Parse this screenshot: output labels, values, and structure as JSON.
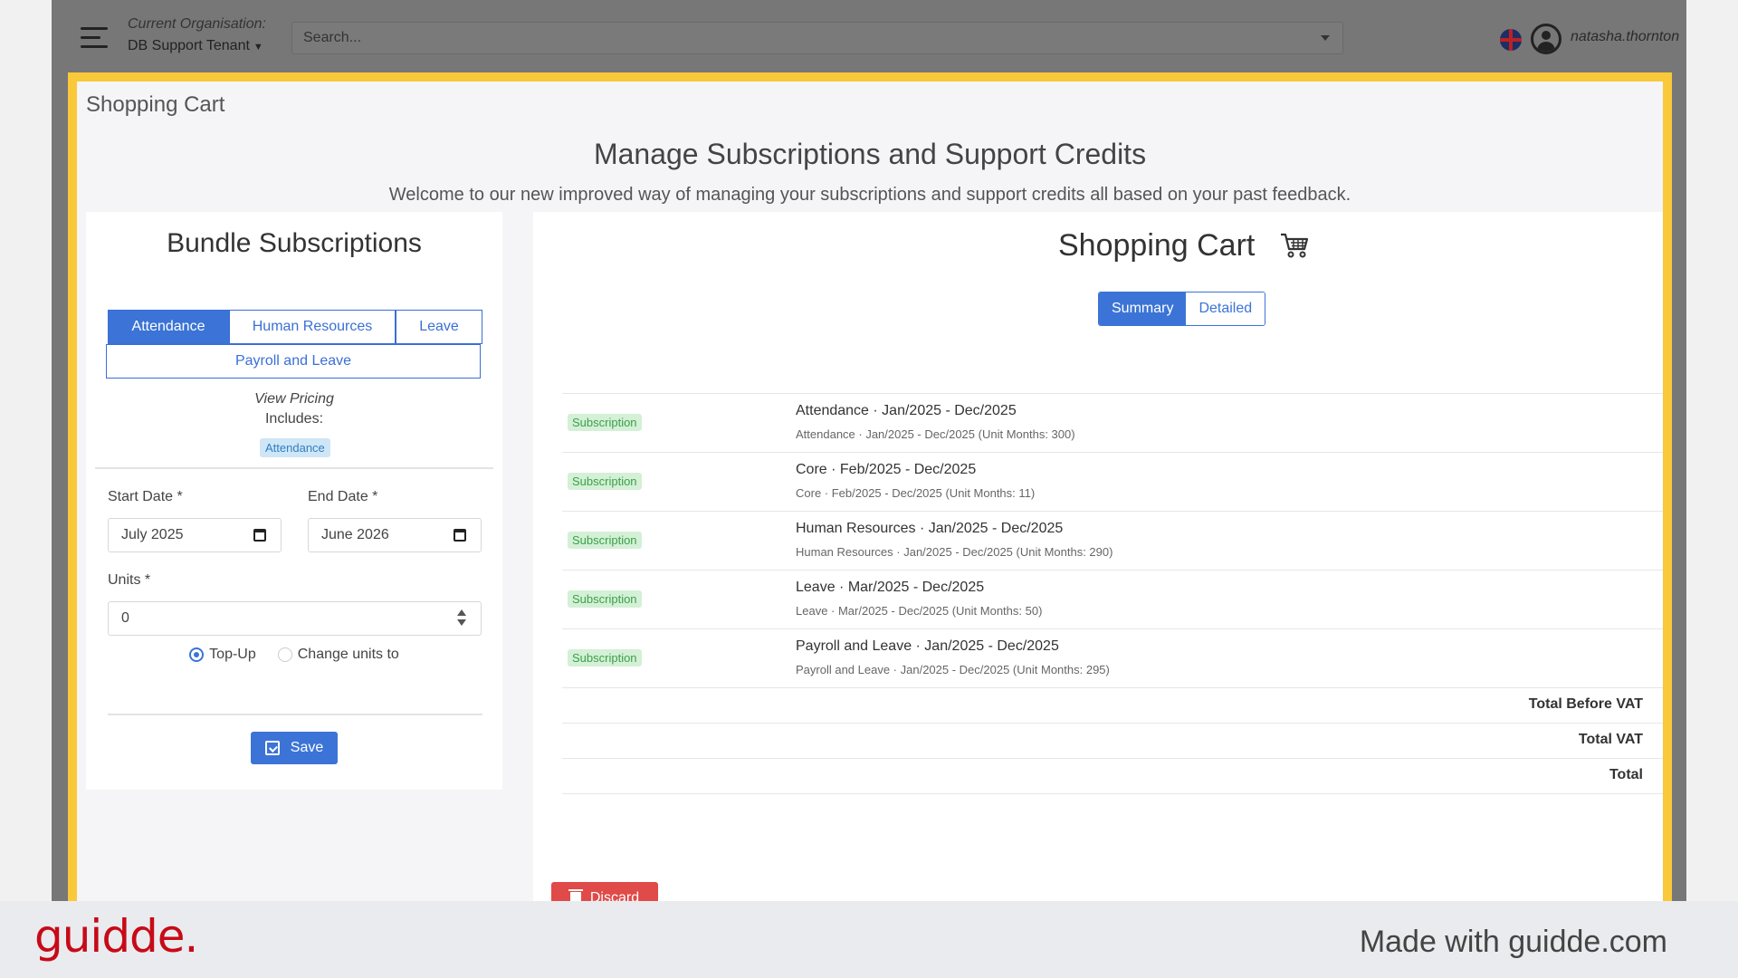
{
  "navbar": {
    "org_label": "Current Organisation:",
    "org_value": "DB Support Tenant",
    "search_placeholder": "Search...",
    "username": "natasha.thornton"
  },
  "page": {
    "heading": "Shopping Cart",
    "title": "Manage Subscriptions and Support Credits",
    "subtitle": "Welcome to our new improved way of managing your subscriptions and support credits all based on your past feedback."
  },
  "bundle": {
    "title": "Bundle Subscriptions",
    "tabs": [
      "Attendance",
      "Human Resources",
      "Leave"
    ],
    "tab_wide": "Payroll and Leave",
    "active_tab": "Attendance",
    "view_pricing": "View Pricing",
    "includes_label": "Includes:",
    "includes_badge": "Attendance",
    "start_date_label": "Start Date *",
    "start_date_value": "July 2025",
    "end_date_label": "End Date *",
    "end_date_value": "June 2026",
    "units_label": "Units *",
    "units_value": "0",
    "radio_topup": "Top-Up",
    "radio_change": "Change units to",
    "save_label": "Save"
  },
  "cart": {
    "title": "Shopping Cart",
    "toggle_summary": "Summary",
    "toggle_detailed": "Detailed",
    "items": [
      {
        "badge": "Subscription",
        "title": "Attendance · Jan/2025 - Dec/2025",
        "sub": "Attendance · Jan/2025 - Dec/2025 (Unit Months: 300)"
      },
      {
        "badge": "Subscription",
        "title": "Core · Feb/2025 - Dec/2025",
        "sub": "Core · Feb/2025 - Dec/2025 (Unit Months: 11)"
      },
      {
        "badge": "Subscription",
        "title": "Human Resources · Jan/2025 - Dec/2025",
        "sub": "Human Resources · Jan/2025 - Dec/2025 (Unit Months: 290)"
      },
      {
        "badge": "Subscription",
        "title": "Leave · Mar/2025 - Dec/2025",
        "sub": "Leave · Mar/2025 - Dec/2025 (Unit Months: 50)"
      },
      {
        "badge": "Subscription",
        "title": "Payroll and Leave · Jan/2025 - Dec/2025",
        "sub": "Payroll and Leave · Jan/2025 - Dec/2025 (Unit Months: 295)"
      }
    ],
    "total_before_vat": "Total Before VAT",
    "total_vat": "Total VAT",
    "total": "Total",
    "discard_label": "Discard"
  },
  "footer": {
    "logo": "guidde.",
    "made_with": "Made with guidde.com"
  },
  "colors": {
    "primary": "#3b74d6",
    "highlight": "#f9c93a",
    "danger": "#e04a48",
    "brand": "#c70a17"
  }
}
